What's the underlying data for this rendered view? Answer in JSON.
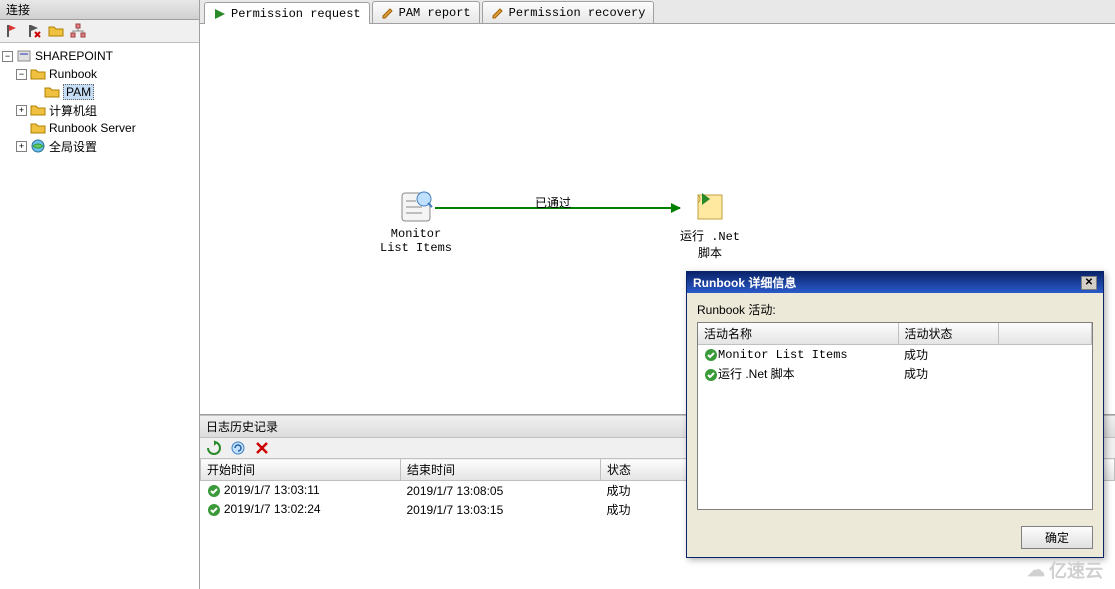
{
  "leftPanel": {
    "title": "连接",
    "tree": {
      "root": "SHAREPOINT",
      "items": [
        {
          "label": "Runbook",
          "expanded": true
        },
        {
          "label": "PAM",
          "selected": true
        },
        {
          "label": "计算机组"
        },
        {
          "label": "Runbook Server"
        },
        {
          "label": "全局设置"
        }
      ]
    }
  },
  "tabs": [
    {
      "label": "Permission request",
      "active": true,
      "icon": "play"
    },
    {
      "label": "PAM report",
      "icon": "pencil"
    },
    {
      "label": "Permission recovery",
      "icon": "pencil"
    }
  ],
  "canvas": {
    "activity1": {
      "line1": "Monitor",
      "line2": "List Items"
    },
    "activity2": {
      "line1": "运行 .Net",
      "line2": "脚本"
    },
    "linkLabel": "已通过"
  },
  "log": {
    "header": "日志历史记录",
    "columns": {
      "start": "开始时间",
      "end": "结束时间",
      "status": "状态"
    },
    "rows": [
      {
        "start": "2019/1/7 13:03:11",
        "end": "2019/1/7 13:08:05",
        "status": "成功"
      },
      {
        "start": "2019/1/7 13:02:24",
        "end": "2019/1/7 13:03:15",
        "status": "成功"
      }
    ]
  },
  "dialog": {
    "title": "Runbook 详细信息",
    "label": "Runbook 活动:",
    "columns": {
      "name": "活动名称",
      "state": "活动状态"
    },
    "rows": [
      {
        "name": "Monitor List Items",
        "state": "成功"
      },
      {
        "name": "运行 .Net 脚本",
        "state": "成功"
      }
    ],
    "okButton": "确定"
  },
  "watermark": "亿速云"
}
